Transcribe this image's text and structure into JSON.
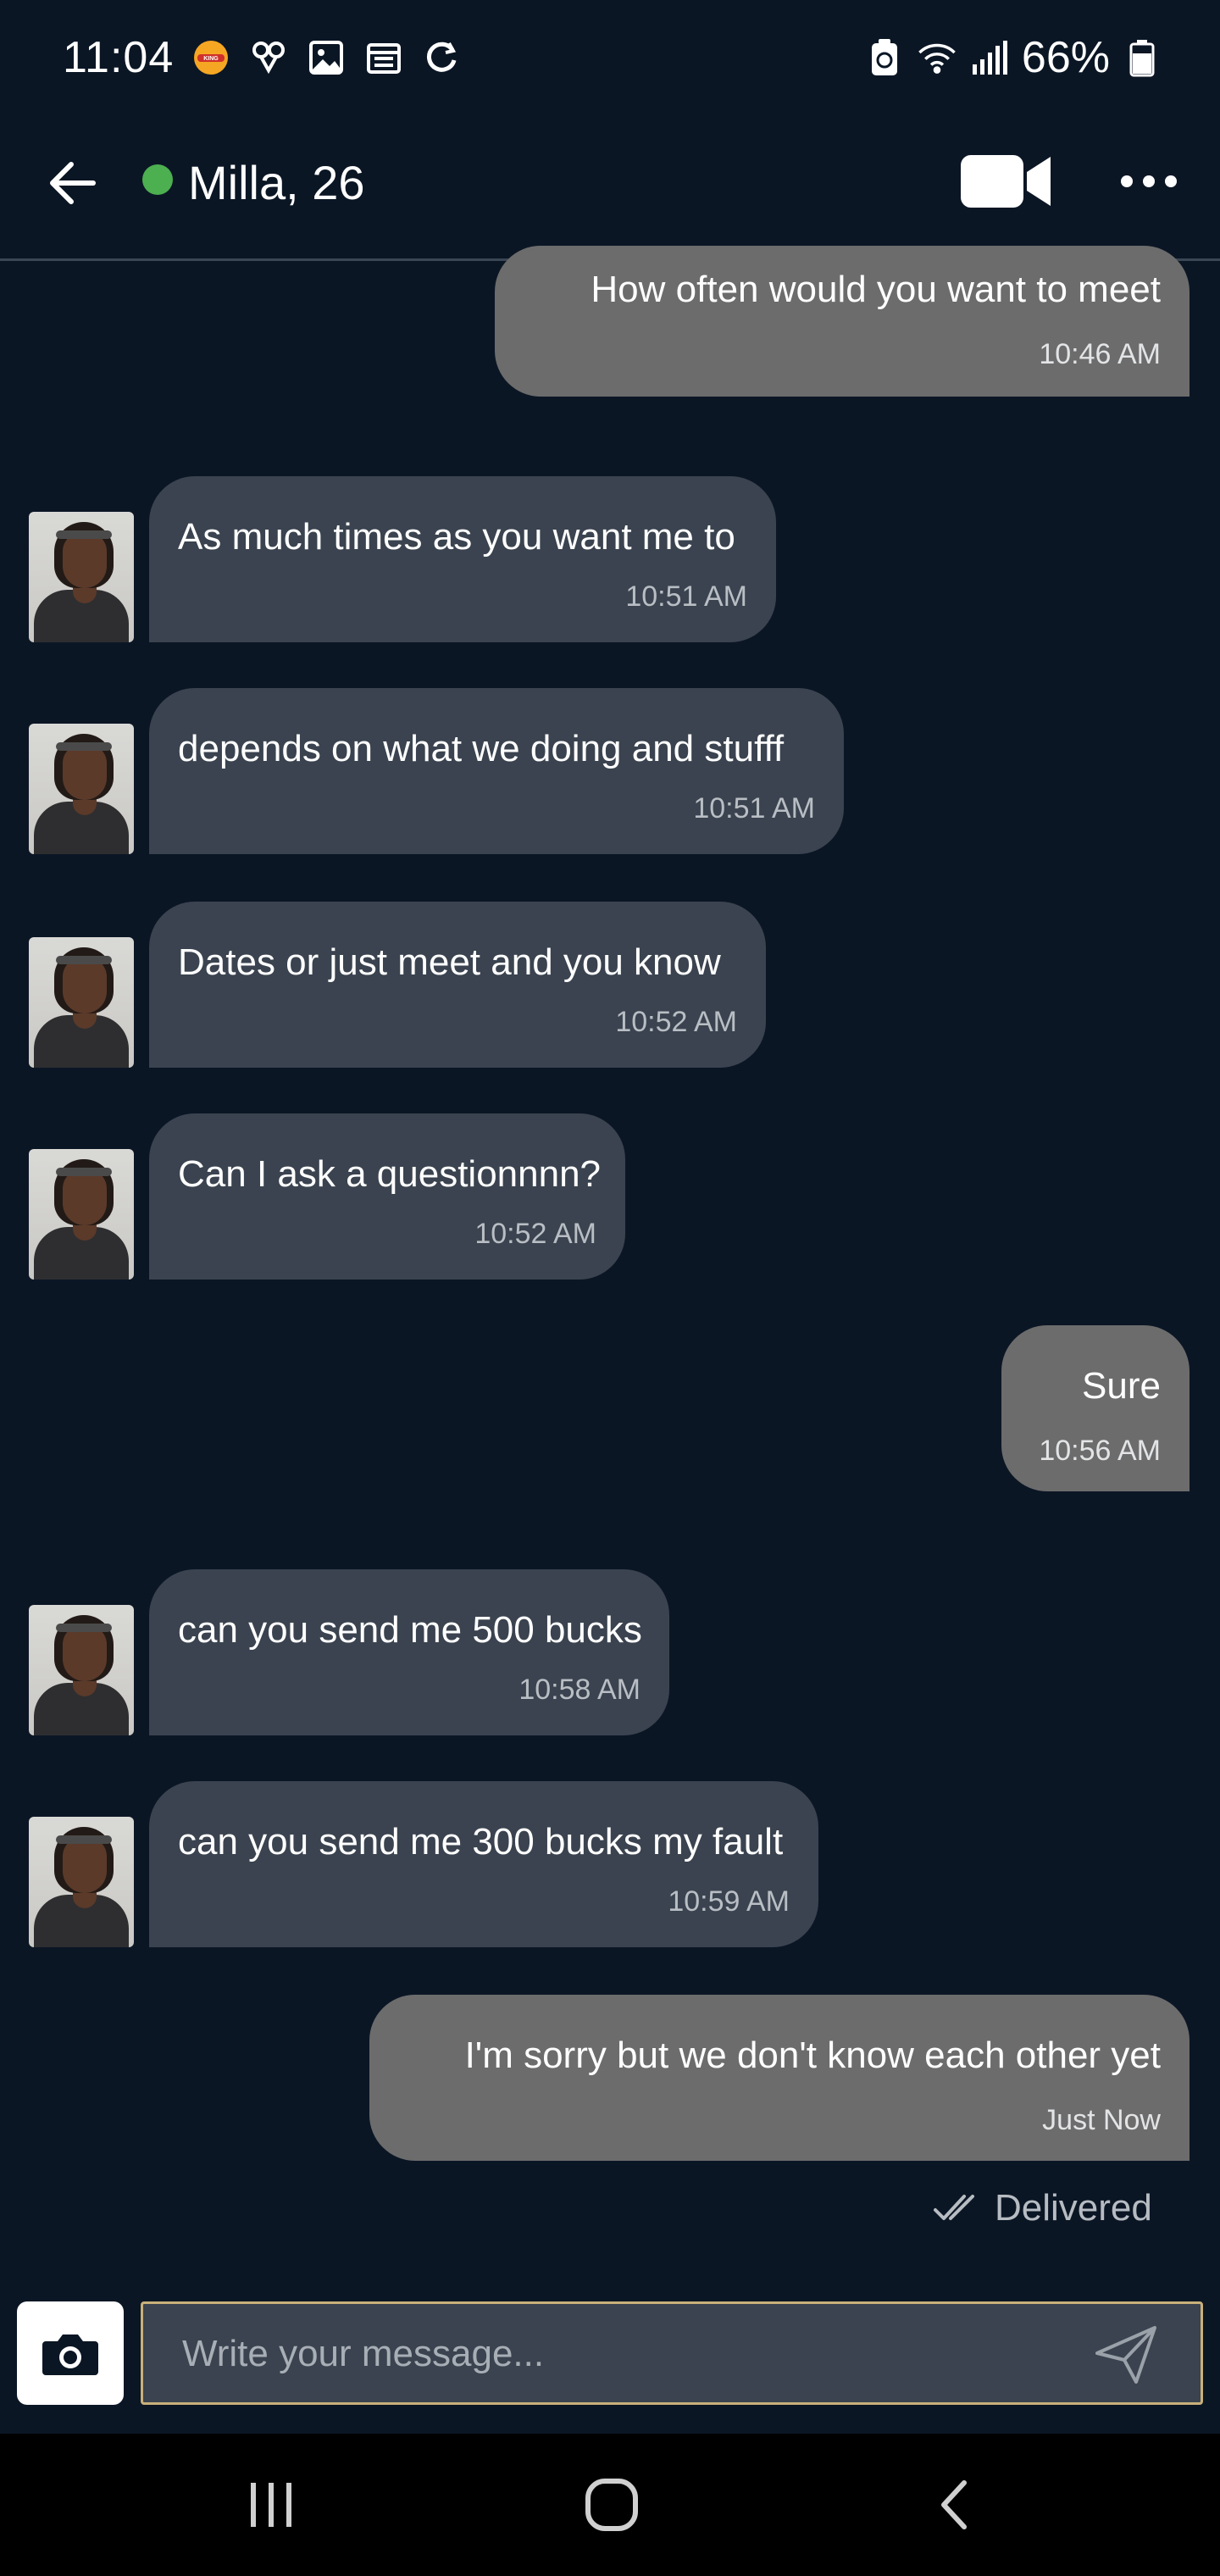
{
  "status_bar": {
    "time": "11:04",
    "battery": "66%",
    "icons": [
      "burger-king-icon",
      "network-icon",
      "gallery-icon",
      "calendar-icon",
      "sync-icon",
      "battery-saver-icon",
      "wifi-icon",
      "signal-icon",
      "battery-icon"
    ]
  },
  "header": {
    "contact_name": "Milla, 26",
    "online_color": "#4caf50"
  },
  "messages": [
    {
      "direction": "out",
      "text": "How often would you want to meet",
      "time": "10:46 AM"
    },
    {
      "direction": "in",
      "text": "As much times as you want me to",
      "time": "10:51 AM"
    },
    {
      "direction": "in",
      "text": "depends on what we doing and stufff",
      "time": "10:51 AM"
    },
    {
      "direction": "in",
      "text": "Dates or just meet and you know",
      "time": "10:52 AM"
    },
    {
      "direction": "in",
      "text": "Can I ask a questionnnn?",
      "time": "10:52 AM"
    },
    {
      "direction": "out",
      "text": "Sure",
      "time": "10:56 AM"
    },
    {
      "direction": "in",
      "text": "can you send me 500 bucks",
      "time": "10:58 AM"
    },
    {
      "direction": "in",
      "text": "can you send me 300 bucks my fault",
      "time": "10:59 AM"
    },
    {
      "direction": "out",
      "text": "I'm sorry but we don't know each other yet",
      "time": "Just Now"
    }
  ],
  "delivery_status": "Delivered",
  "composer": {
    "placeholder": "Write your message..."
  },
  "colors": {
    "background": "#0b1625",
    "incoming_bubble": "#3a434f",
    "outgoing_bubble": "#6c6c6c",
    "composer_border": "#c9b07a"
  }
}
